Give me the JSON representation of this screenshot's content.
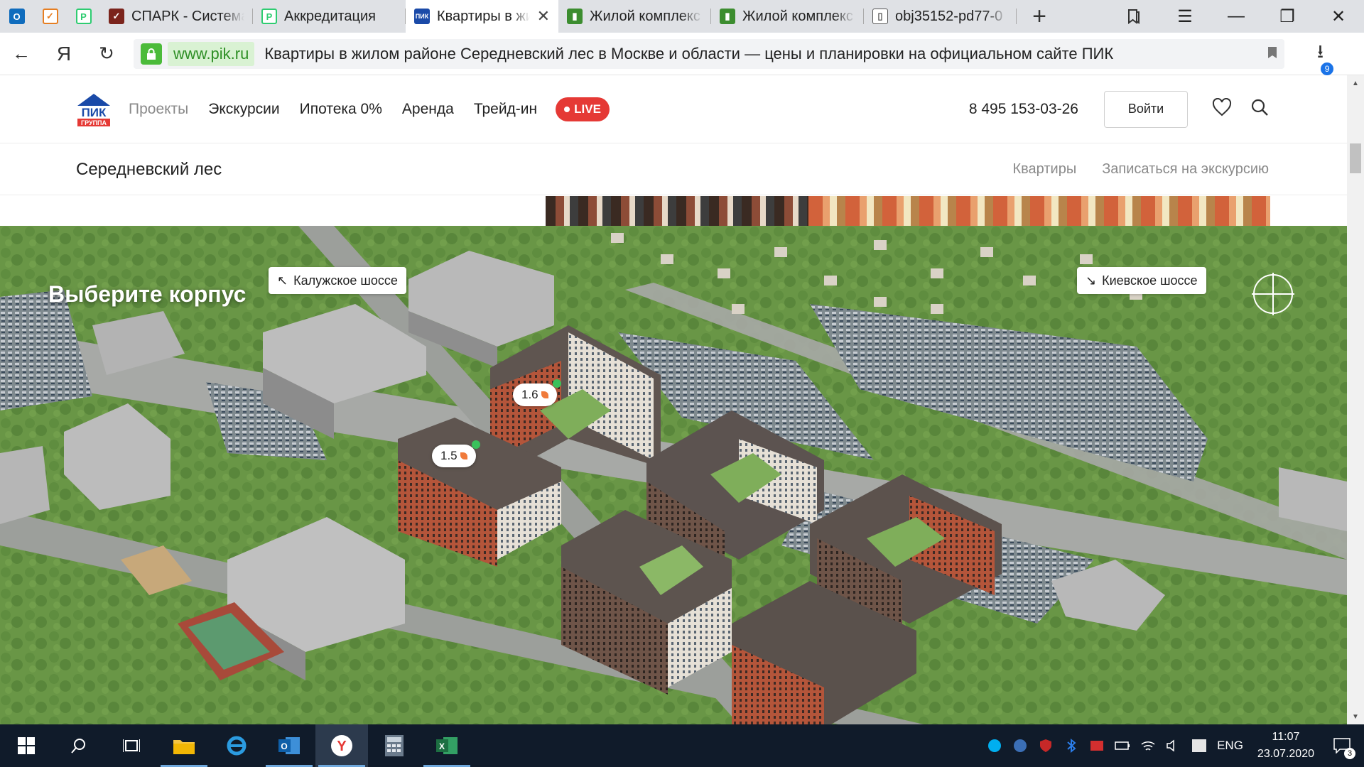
{
  "browser": {
    "tabs": [
      {
        "title": "СПАРК - Система",
        "icon": "spark-icon",
        "color": "#c0392b"
      },
      {
        "title": "Аккредитация",
        "icon": "accreditation-icon",
        "color": "#2ecc71"
      },
      {
        "title": "Квартиры в жилом",
        "icon": "pik-icon",
        "color": "#1a4aa8",
        "active": true
      },
      {
        "title": "Жилой комплекс",
        "icon": "chart-icon",
        "color": "#3c8d2f"
      },
      {
        "title": "Жилой комплекс",
        "icon": "chart-icon",
        "color": "#3c8d2f"
      },
      {
        "title": "obj35152-pd77-0",
        "icon": "document-icon",
        "color": "#555555"
      }
    ],
    "domain": "www.pik.ru",
    "page_title": "Квартиры в жилом районе Середневский лес в Москве и области — цены и планировки на официальном сайте ПИК",
    "downloads_count": "9"
  },
  "site": {
    "logo_text": "ПИК",
    "logo_sub": "ГРУППА",
    "menu": [
      "Проекты",
      "Экскурсии",
      "Ипотека 0%",
      "Аренда",
      "Трейд-ин"
    ],
    "live_label": "LIVE",
    "phone": "8 495 153-03-26",
    "login_label": "Войти"
  },
  "subnav": {
    "title": "Середневский лес",
    "links": [
      "Квартиры",
      "Записаться на экскурсию"
    ]
  },
  "map": {
    "heading": "Выберите корпус",
    "left_direction": "Калужское шоссе",
    "right_direction": "Киевское шоссе",
    "pins": [
      "1.6",
      "1.5"
    ]
  },
  "taskbar": {
    "lang": "ENG",
    "time": "11:07",
    "date": "23.07.2020",
    "notifications": "3"
  }
}
